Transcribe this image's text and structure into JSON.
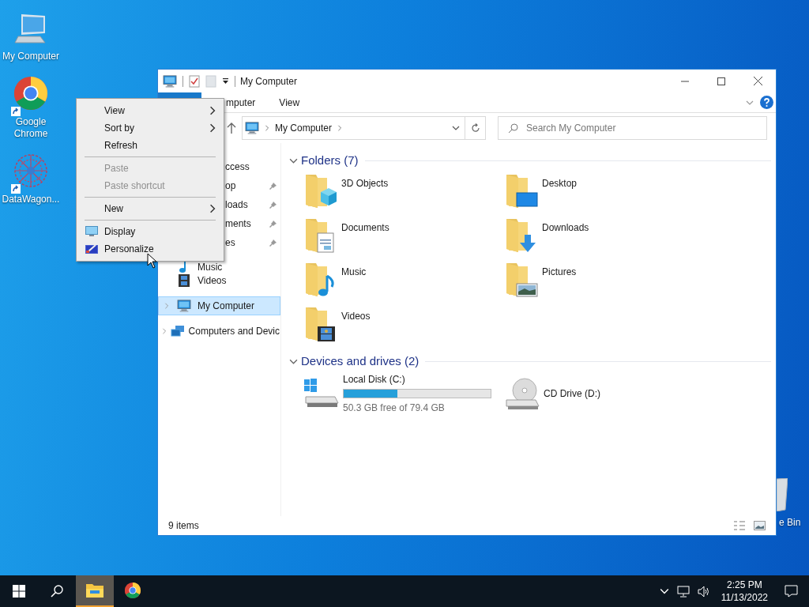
{
  "desktop_icons": [
    {
      "label": "My Computer",
      "kind": "computer"
    },
    {
      "label": "Google Chrome",
      "kind": "chrome"
    },
    {
      "label": "DataWagon...",
      "kind": "app"
    }
  ],
  "recycle_bin": {
    "label": "e Bin"
  },
  "window": {
    "title": "My Computer",
    "ribbon_tabs": [
      {
        "label": "mputer",
        "selected": false
      },
      {
        "label": "View",
        "selected": false
      }
    ],
    "address": {
      "path": "My Computer"
    },
    "search": {
      "placeholder": "Search My Computer"
    },
    "nav_items": [
      {
        "label": "ccess",
        "kind": "star",
        "pinned": false,
        "selected": false
      },
      {
        "label": "op",
        "kind": "desktop",
        "pinned": true,
        "selected": false
      },
      {
        "label": "loads",
        "kind": "download",
        "pinned": true,
        "selected": false
      },
      {
        "label": "ments",
        "kind": "document",
        "pinned": true,
        "selected": false
      },
      {
        "label": "es",
        "kind": "picture",
        "pinned": true,
        "selected": false
      },
      {
        "label": "Music",
        "kind": "music",
        "pinned": false,
        "selected": false,
        "expandable": false
      },
      {
        "label": "Videos",
        "kind": "video",
        "pinned": false,
        "selected": false,
        "expandable": false
      },
      {
        "label": "My Computer",
        "kind": "computer",
        "pinned": false,
        "selected": true,
        "expandable": true
      },
      {
        "label": "Computers and Devic",
        "kind": "network",
        "pinned": false,
        "selected": false,
        "expandable": true
      }
    ],
    "groups": [
      {
        "title": "Folders (7)",
        "expanded": true,
        "items": [
          {
            "label": "3D Objects",
            "kind": "objects"
          },
          {
            "label": "Desktop",
            "kind": "desktop"
          },
          {
            "label": "Documents",
            "kind": "document"
          },
          {
            "label": "Downloads",
            "kind": "download"
          },
          {
            "label": "Music",
            "kind": "music"
          },
          {
            "label": "Pictures",
            "kind": "picture"
          },
          {
            "label": "Videos",
            "kind": "video"
          }
        ]
      },
      {
        "title": "Devices and drives (2)",
        "expanded": true,
        "items": [
          {
            "label": "Local Disk (C:)",
            "kind": "disk",
            "level": 0.366,
            "detail": "50.3 GB free of 79.4 GB"
          },
          {
            "label": "CD Drive (D:)",
            "kind": "cd"
          }
        ]
      }
    ],
    "status_bar": {
      "text": "9 items"
    }
  },
  "context_menu": [
    {
      "kind": "item",
      "label": "View",
      "submenu": true,
      "disabled": false
    },
    {
      "kind": "item",
      "label": "Sort by",
      "submenu": true,
      "disabled": false
    },
    {
      "kind": "item",
      "label": "Refresh",
      "submenu": false,
      "disabled": false
    },
    {
      "kind": "separator"
    },
    {
      "kind": "item",
      "label": "Paste",
      "submenu": false,
      "disabled": true
    },
    {
      "kind": "item",
      "label": "Paste shortcut",
      "submenu": false,
      "disabled": true
    },
    {
      "kind": "separator"
    },
    {
      "kind": "item",
      "label": "New",
      "submenu": true,
      "disabled": false
    },
    {
      "kind": "separator"
    },
    {
      "kind": "item",
      "label": "Display",
      "submenu": false,
      "disabled": false
    },
    {
      "kind": "item",
      "label": "Personalize",
      "submenu": false,
      "disabled": false
    }
  ],
  "taskbar": {
    "apps": [
      {
        "kind": "explorer",
        "active": true
      },
      {
        "kind": "chrome",
        "active": false
      }
    ],
    "time": "2:25 PM",
    "date": "11/13/2022"
  }
}
